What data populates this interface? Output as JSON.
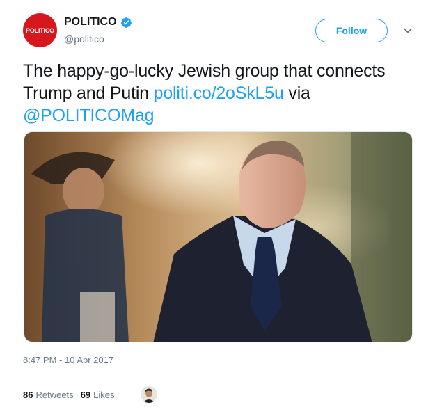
{
  "author": {
    "avatar_text": "POLITICO",
    "display_name": "POLITICO",
    "handle": "@politico",
    "verified": true,
    "brand_color": "#d6181e"
  },
  "actions": {
    "follow_label": "Follow",
    "more_icon": "chevron-down-icon"
  },
  "tweet": {
    "text_part1": "The happy-go-lucky Jewish group that connects Trump and Putin ",
    "link": "politi.co/2oSkL5u",
    "text_part2": " via ",
    "mention": "@POLITICOMag",
    "link_color": "#1da1f2"
  },
  "media": {
    "description_icon": "photo"
  },
  "meta": {
    "timestamp": "8:47 PM - 10 Apr 2017"
  },
  "stats": {
    "retweets_count": "86",
    "retweets_label": "Retweets",
    "likes_count": "69",
    "likes_label": "Likes"
  }
}
